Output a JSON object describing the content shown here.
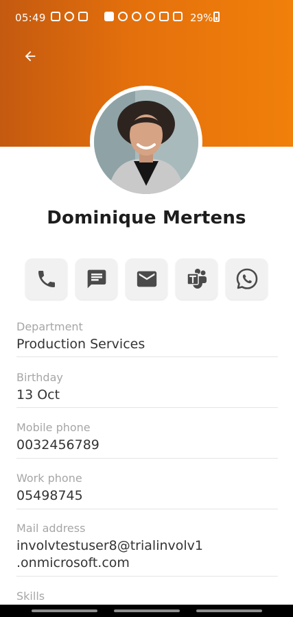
{
  "status_bar": {
    "time": "05:49",
    "battery": "29%"
  },
  "header": {
    "back_icon": "arrow-back-icon",
    "gradient_start": "#c45a10",
    "gradient_end": "#f0800a"
  },
  "profile": {
    "name": "Dominique Mertens"
  },
  "actions": [
    {
      "icon": "phone-icon"
    },
    {
      "icon": "message-icon"
    },
    {
      "icon": "email-icon"
    },
    {
      "icon": "teams-icon"
    },
    {
      "icon": "whatsapp-icon"
    }
  ],
  "fields": [
    {
      "label": "Department",
      "value": "Production Services"
    },
    {
      "label": "Birthday",
      "value": "13 Oct"
    },
    {
      "label": "Mobile phone",
      "value": "0032456789"
    },
    {
      "label": "Work phone",
      "value": "05498745"
    },
    {
      "label": "Mail address",
      "value_line1": "involvtestuser8@trialinvolv1",
      "value_line2": ".onmicrosoft.com"
    },
    {
      "label": "Skills"
    }
  ],
  "colors": {
    "accent": "#e4700c",
    "action_icon": "#4a4a4a",
    "label": "#a6a6a6",
    "value": "#333333"
  }
}
